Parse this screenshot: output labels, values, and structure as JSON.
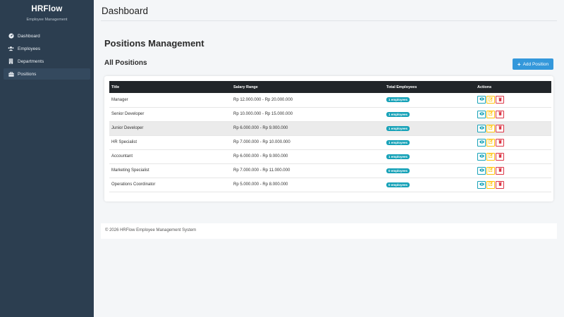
{
  "brand": {
    "title": "HRFlow",
    "subtitle": "Employee Management"
  },
  "sidebar": {
    "items": [
      {
        "label": "Dashboard",
        "icon": "dashboard-icon"
      },
      {
        "label": "Employees",
        "icon": "users-icon"
      },
      {
        "label": "Departments",
        "icon": "building-icon"
      },
      {
        "label": "Positions",
        "icon": "briefcase-icon",
        "active": true
      }
    ]
  },
  "topbar": {
    "title": "Dashboard"
  },
  "page": {
    "title": "Positions Management",
    "section_title": "All Positions",
    "add_button": "Add Position"
  },
  "table": {
    "headers": [
      "Title",
      "Salary Range",
      "Total Employees",
      "Actions"
    ],
    "rows": [
      {
        "title": "Manager",
        "salary": "Rp 12.000.000 - Rp 20.000.000",
        "employees": "1 employees"
      },
      {
        "title": "Senior Developer",
        "salary": "Rp 10.000.000 - Rp 15.000.000",
        "employees": "1 employees"
      },
      {
        "title": "Junior Developer",
        "salary": "Rp 6.000.000 - Rp 9.000.000",
        "employees": "1 employees"
      },
      {
        "title": "HR Specialist",
        "salary": "Rp 7.000.000 - Rp 10.000.000",
        "employees": "1 employees"
      },
      {
        "title": "Accountant",
        "salary": "Rp 6.000.000 - Rp 9.000.000",
        "employees": "1 employees"
      },
      {
        "title": "Marketing Specialist",
        "salary": "Rp 7.000.000 - Rp 11.000.000",
        "employees": "0 employees"
      },
      {
        "title": "Operations Coordinator",
        "salary": "Rp 5.000.000 - Rp 8.000.000",
        "employees": "0 employees"
      }
    ]
  },
  "footer": {
    "text": "© 2026 HRFlow Employee Management System"
  },
  "colors": {
    "sidebar_bg": "#2c3e50",
    "primary": "#3498db",
    "badge": "#17a2b8",
    "view": "#17a2b8",
    "edit": "#ffc107",
    "delete": "#dc3545"
  }
}
